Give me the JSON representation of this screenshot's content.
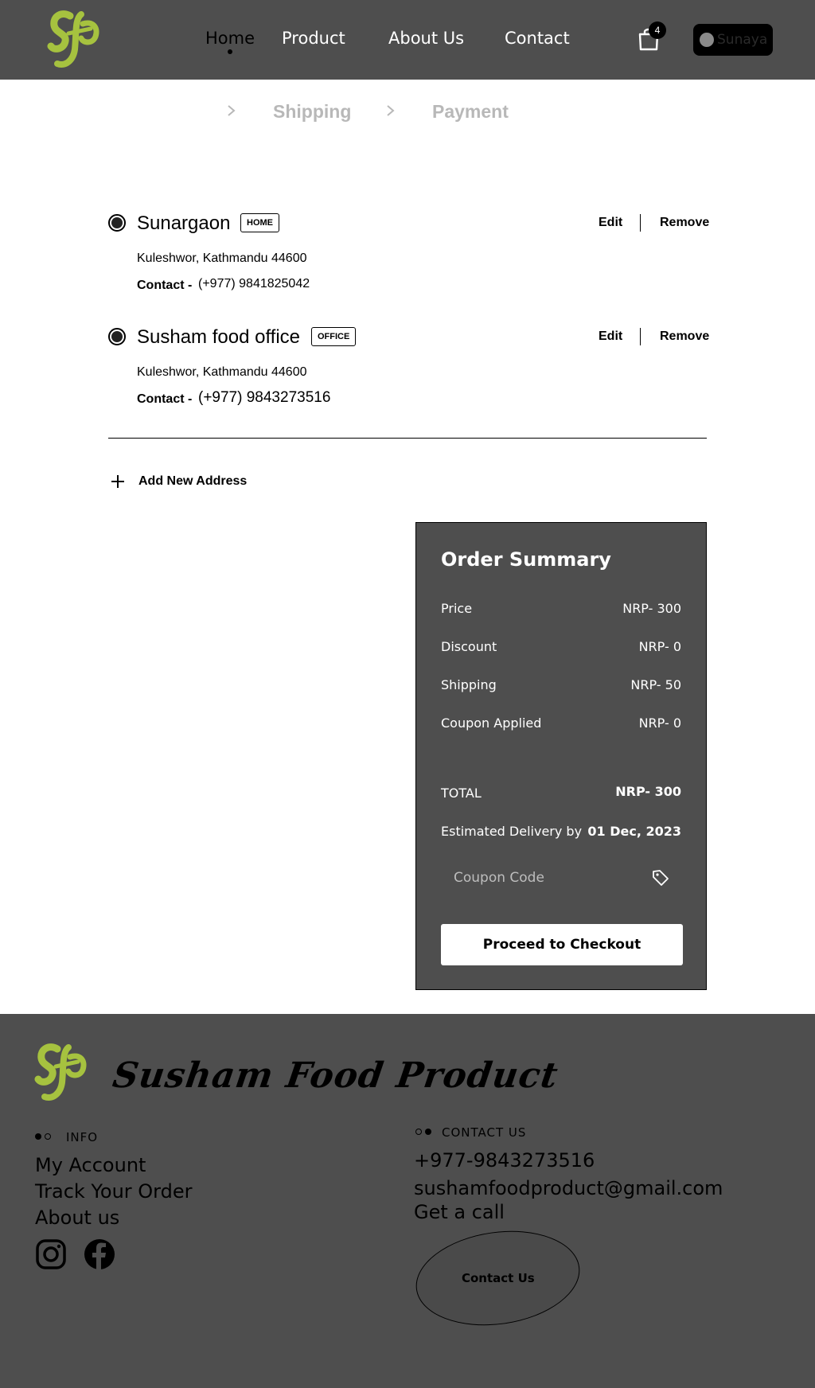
{
  "header": {
    "nav": [
      "Home",
      "Product",
      "About Us",
      "Contact"
    ],
    "cart_count": "4",
    "user_name": "Sunaya"
  },
  "breadcrumb": [
    "Shipping",
    "Payment"
  ],
  "addresses": [
    {
      "name": "Sunargaon",
      "tag": "HOME",
      "line": "Kuleshwor, Kathmandu 44600",
      "contact_label": "Contact -",
      "contact": "(+977) 9841825042",
      "edit": "Edit",
      "remove": "Remove"
    },
    {
      "name": "Susham food office",
      "tag": "OFFICE",
      "line": "Kuleshwor, Kathmandu 44600",
      "contact_label": "Contact -",
      "contact": "(+977) 9843273516",
      "edit": "Edit",
      "remove": "Remove"
    }
  ],
  "add_new_address": "Add New Address",
  "summary": {
    "title": "Order Summary",
    "rows": [
      {
        "label": "Price",
        "value": "NRP- 300"
      },
      {
        "label": "Discount",
        "value": "NRP- 0"
      },
      {
        "label": "Shipping",
        "value": "NRP- 50"
      },
      {
        "label": "Coupon Applied",
        "value": "NRP- 0"
      }
    ],
    "total_label": "TOTAL",
    "total_value": "NRP- 300",
    "delivery_label": "Estimated Delivery by",
    "delivery_value": "01 Dec, 2023",
    "coupon_placeholder": "Coupon Code",
    "checkout": "Proceed to Checkout"
  },
  "footer": {
    "brand": "Susham Food Product",
    "info_head": "INFO",
    "info_links": [
      "My Account",
      "Track Your Order",
      "About us"
    ],
    "contact_head": "CONTACT US",
    "phone": "+977-9843273516",
    "email": "sushamfoodproduct@gmail.com",
    "get_call": "Get a call",
    "contact_button": "Contact Us"
  },
  "colors": {
    "header_bg": "#4e4e4e",
    "logo_green": "#a6c23f",
    "muted": "#b8b8b8"
  }
}
